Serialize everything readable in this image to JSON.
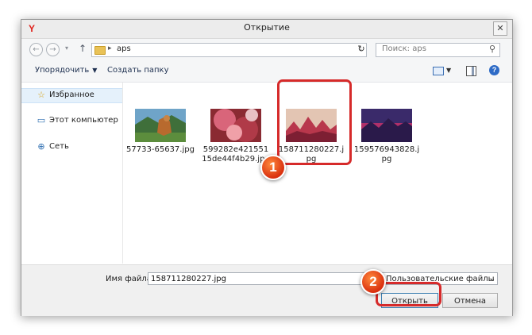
{
  "window": {
    "title": "Открытие",
    "close_glyph": "✕"
  },
  "nav": {
    "back_glyph": "←",
    "forward_glyph": "→",
    "history_glyph": "▾",
    "up_glyph": "↑",
    "breadcrumb_chevron": "▸",
    "path": "aps",
    "address_dropdown_glyph": "⌄",
    "refresh_glyph": "↻",
    "search_placeholder": "Поиск: aps",
    "search_glyph": "⚲"
  },
  "toolbar": {
    "organize_label": "Упорядочить",
    "organize_caret": "▼",
    "new_folder_label": "Создать папку",
    "view_caret": "▼",
    "help_glyph": "?"
  },
  "sidebar": {
    "items": [
      {
        "label": "Избранное",
        "icon": "star-icon",
        "glyph": "☆"
      },
      {
        "label": "Этот компьютер",
        "icon": "computer-icon",
        "glyph": "▭"
      },
      {
        "label": "Сеть",
        "icon": "network-icon",
        "glyph": "⊕"
      }
    ]
  },
  "files": [
    {
      "name": "57733-65637.jpg",
      "thumb": "wolf-landscape"
    },
    {
      "name": "599282e42155115de44f4b29.jpg",
      "thumb": "pink-nebula"
    },
    {
      "name": "158711280227.jpg",
      "thumb": "pink-mountains",
      "selected": true
    },
    {
      "name": "159576943828.jpg",
      "thumb": "purple-mountains"
    }
  ],
  "bottom": {
    "filename_label": "Имя файла:",
    "filename_value": "158711280227.jpg",
    "filetype_value": "Пользовательские файлы (*.jf",
    "filetype_dropdown_glyph": "⌄",
    "open_label": "Открыть",
    "cancel_label": "Отмена"
  },
  "annotations": {
    "step1": "1",
    "step2": "2",
    "highlight_color": "#d62a2a"
  }
}
